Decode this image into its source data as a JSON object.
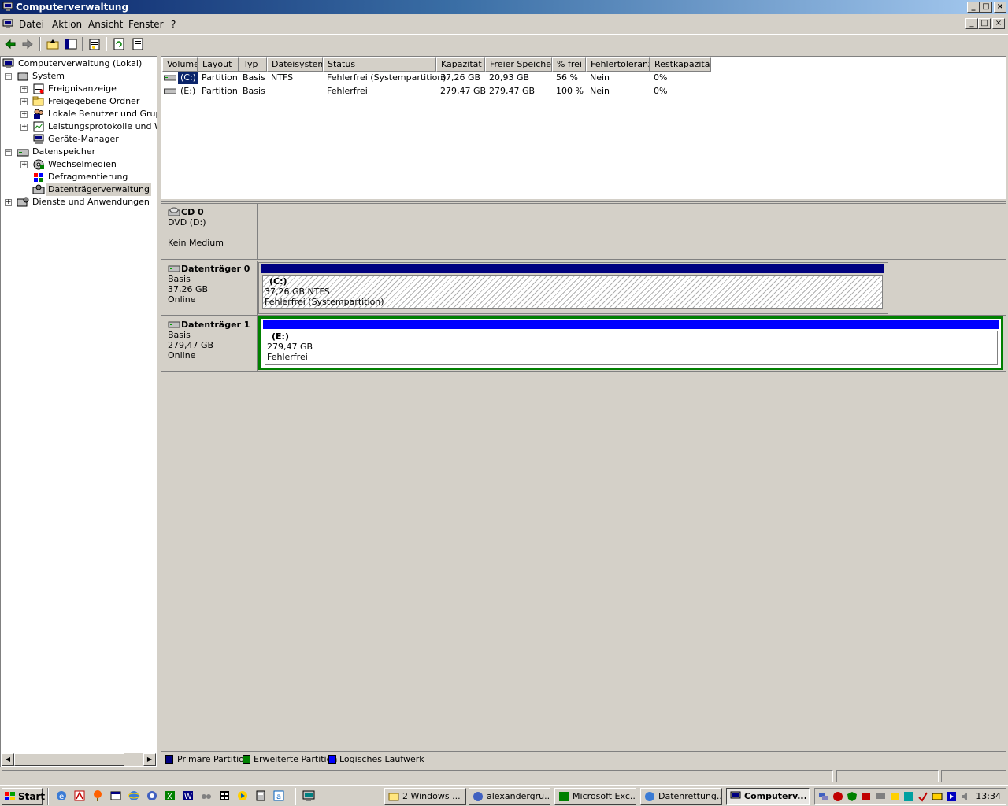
{
  "window": {
    "title": "Computerverwaltung",
    "caption_buttons": [
      "_",
      "□",
      "×"
    ]
  },
  "menubar": {
    "items": [
      "Datei",
      "Aktion",
      "Ansicht",
      "Fenster",
      "?"
    ]
  },
  "toolbar": {
    "icons": [
      "back-icon",
      "forward-icon",
      "up-folder-icon",
      "show-hide-tree-icon",
      "properties-icon",
      "refresh-icon",
      "export-list-icon"
    ]
  },
  "tree": {
    "root": "Computerverwaltung (Lokal)",
    "system": "System",
    "ereignis": "Ereignisanzeige",
    "freigegeben": "Freigegebene Ordner",
    "lokale": "Lokale Benutzer und Gruppen",
    "leistung": "Leistungsprotokolle und Warnungen",
    "geraete": "Geräte-Manager",
    "datenspeicher": "Datenspeicher",
    "wechsel": "Wechselmedien",
    "defrag": "Defragmentierung",
    "datentraeger": "Datenträgerverwaltung",
    "dienste": "Dienste und Anwendungen",
    "expander_plus": "+",
    "expander_minus": "−"
  },
  "volume_table": {
    "columns": [
      "Volume",
      "Layout",
      "Typ",
      "Dateisystem",
      "Status",
      "Kapazität",
      "Freier Speicher",
      "% frei",
      "Fehlertoleranz",
      "Restkapazität"
    ],
    "rows": [
      [
        "(C:)",
        "Partition",
        "Basis",
        "NTFS",
        "Fehlerfrei (Systempartition)",
        "37,26 GB",
        "20,93 GB",
        "56 %",
        "Nein",
        "0%"
      ],
      [
        "(E:)",
        "Partition",
        "Basis",
        "",
        "Fehlerfrei",
        "279,47 GB",
        "279,47 GB",
        "100 %",
        "Nein",
        "0%"
      ]
    ]
  },
  "disks": {
    "cd0": {
      "name": "CD 0",
      "type": "DVD (D:)",
      "status": "Kein Medium"
    },
    "disk0": {
      "name": "Datenträger 0",
      "type": "Basis",
      "size": "37,26 GB",
      "status": "Online",
      "partition": {
        "name": "(C:)",
        "size": "37,26 GB NTFS",
        "status": "Fehlerfrei (Systempartition)"
      }
    },
    "disk1": {
      "name": "Datenträger 1",
      "type": "Basis",
      "size": "279,47 GB",
      "status": "Online",
      "partition": {
        "name": "(E:)",
        "size": "279,47 GB",
        "status": "Fehlerfrei"
      }
    }
  },
  "legend": {
    "items": [
      {
        "label": "Primäre Partition",
        "color": "#000080"
      },
      {
        "label": "Erweiterte Partition",
        "color": "#008000"
      },
      {
        "label": "Logisches Laufwerk",
        "color": "#0000ff"
      }
    ]
  },
  "colors": {
    "primary_partition": "#000080",
    "logical_drive": "#0000ff",
    "extended_partition": "#008000",
    "selection": "#0a246a"
  },
  "taskbar": {
    "start": "Start",
    "tasks": [
      "2 Windows ...",
      "alexandergru...",
      "Microsoft Exc...",
      "Datenrettung...",
      "Computerv..."
    ],
    "clock": "13:34"
  }
}
